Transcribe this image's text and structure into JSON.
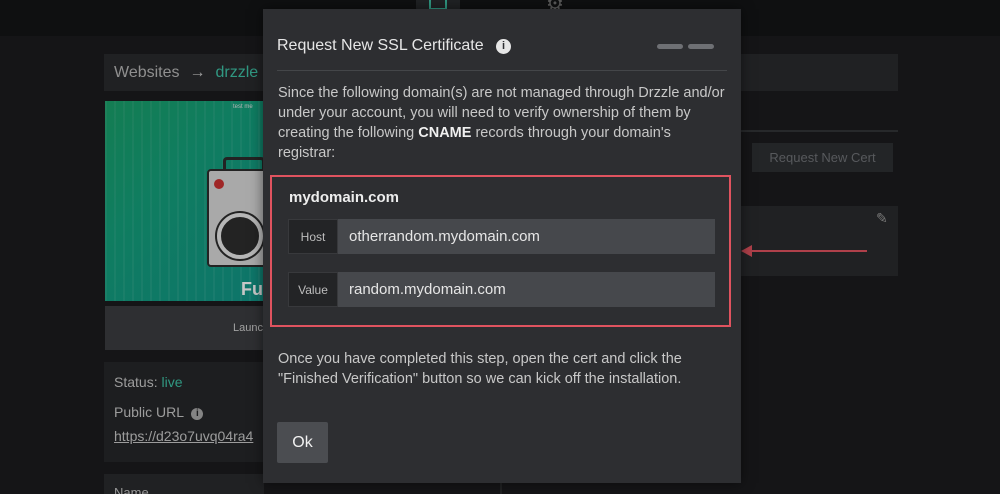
{
  "breadcrumb": {
    "root": "Websites",
    "arrow": "→",
    "site": "drzzle"
  },
  "thumbnail": {
    "tiny_text": "test me",
    "big_text": "Fu"
  },
  "launch_label": "Launc",
  "info": {
    "status_label": "Status: ",
    "status_value": "live",
    "public_url_label": "Public URL",
    "info_icon": "i",
    "url_text": "https://d23o7uvq04ra4"
  },
  "name_label": "Name",
  "right": {
    "request_cert_button": "Request New Cert",
    "pencil_icon": "✎"
  },
  "modal": {
    "title": "Request New SSL Certificate",
    "title_info_icon": "i",
    "desc_before": "Since the following domain(s) are not managed through Drzzle and/or under your account, you will need to verify ownership of them by creating the following ",
    "desc_bold": "CNAME",
    "desc_after": " records through your domain's registrar:",
    "record": {
      "domain": "mydomain.com",
      "host_label": "Host",
      "host_value": "otherrandom.mydomain.com",
      "value_label": "Value",
      "value_value": "random.mydomain.com"
    },
    "after_text": "Once you have completed this step, open the cert and click the \"Finished Verification\" button so we can kick off the installation.",
    "ok_label": "Ok"
  },
  "colors": {
    "accent": "#3ec3a7",
    "highlight": "#e0535f",
    "modal_bg": "#2d2e31"
  }
}
